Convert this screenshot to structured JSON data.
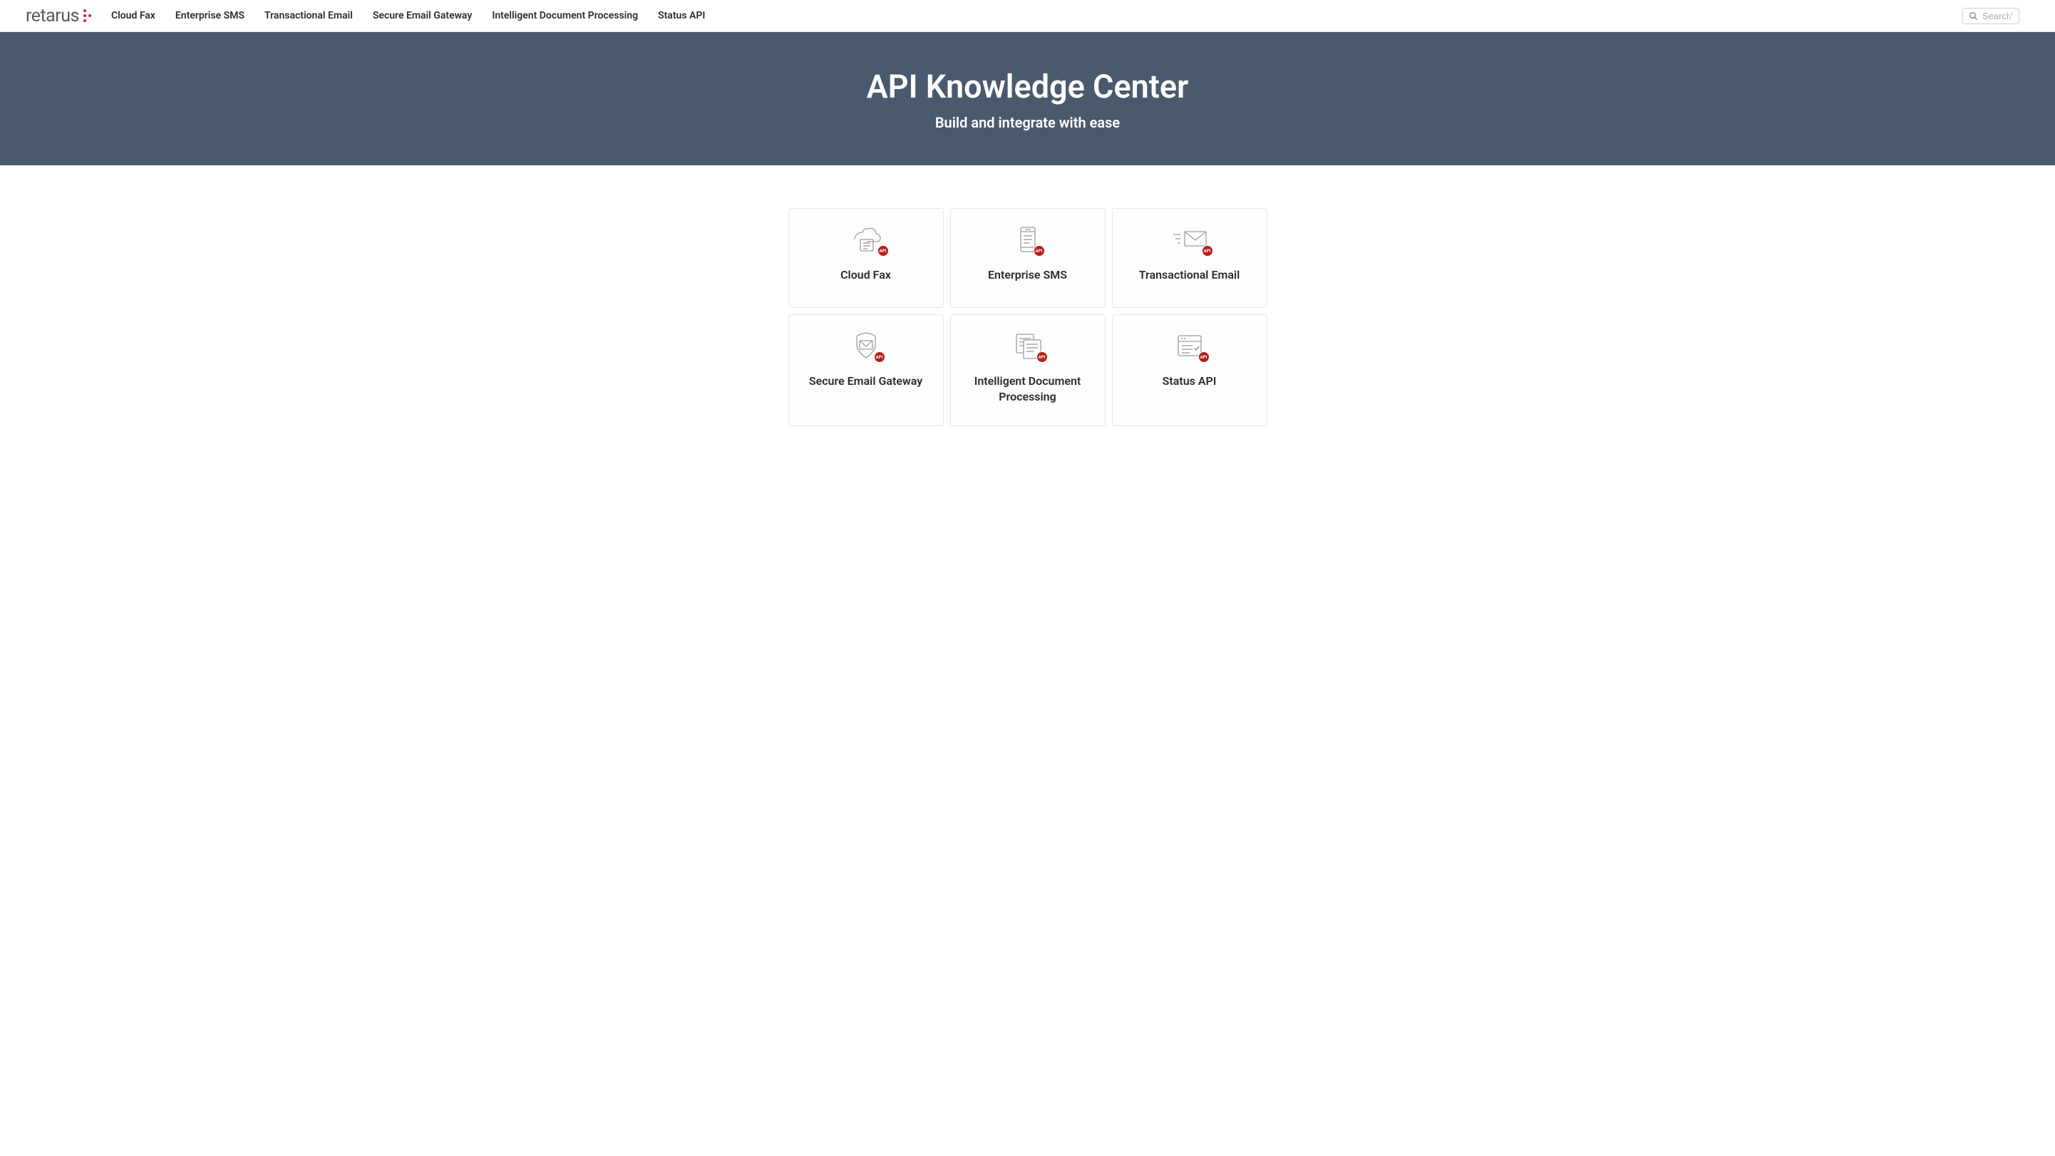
{
  "logo": "retarus",
  "nav": {
    "items": [
      {
        "label": "Cloud Fax"
      },
      {
        "label": "Enterprise SMS"
      },
      {
        "label": "Transactional Email"
      },
      {
        "label": "Secure Email Gateway"
      },
      {
        "label": "Intelligent Document Processing"
      },
      {
        "label": "Status API"
      }
    ]
  },
  "search": {
    "placeholder": "Search",
    "shortcut": "/"
  },
  "hero": {
    "title": "API Knowledge Center",
    "subtitle": "Build and integrate with ease"
  },
  "cards": [
    {
      "title": "Cloud Fax",
      "icon": "fax-icon",
      "badge": "API"
    },
    {
      "title": "Enterprise SMS",
      "icon": "sms-icon",
      "badge": "API"
    },
    {
      "title": "Transactional Email",
      "icon": "email-icon",
      "badge": "API"
    },
    {
      "title": "Secure Email Gateway",
      "icon": "shield-icon",
      "badge": "API"
    },
    {
      "title": "Intelligent Document Processing",
      "icon": "document-icon",
      "badge": "API"
    },
    {
      "title": "Status API",
      "icon": "status-icon",
      "badge": "API"
    }
  ]
}
